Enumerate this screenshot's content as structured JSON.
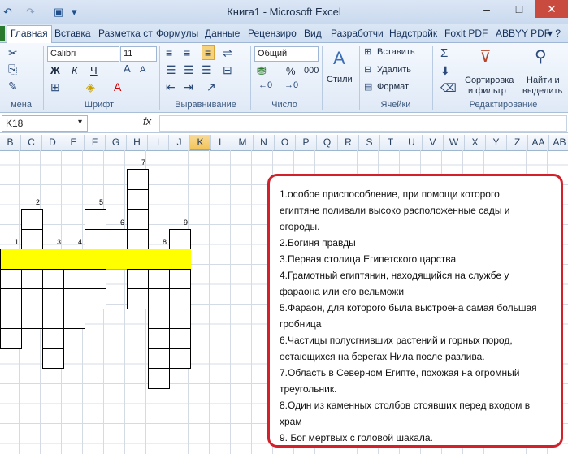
{
  "window": {
    "title": "Книга1 - Microsoft Excel"
  },
  "tabs": [
    "Главная",
    "Вставка",
    "Разметка ст",
    "Формулы",
    "Данные",
    "Рецензиро",
    "Вид",
    "Разработчи",
    "Надстройк",
    "Foxit PDF",
    "ABBYY PDF"
  ],
  "active_tab": "Главная",
  "ribbon": {
    "font_name": "Calibri",
    "font_size": "11",
    "number_format": "Общий",
    "bold": "Ж",
    "italic": "К",
    "underline": "Ч",
    "percent": "%",
    "thousands": "000",
    "styles": "Стили",
    "insert": "Вставить",
    "delete": "Удалить",
    "format": "Формат",
    "sort_filter_1": "Сортировка",
    "sort_filter_2": "и фильтр",
    "find_select_1": "Найти и",
    "find_select_2": "выделить",
    "groups": {
      "clipboard": "мена",
      "font": "Шрифт",
      "alignment": "Выравнивание",
      "number": "Число",
      "cells": "Ячейки",
      "editing": "Редактирование"
    }
  },
  "formula_bar": {
    "name_box": "K18",
    "fx": "fx",
    "content": ""
  },
  "columns": [
    "B",
    "C",
    "D",
    "E",
    "F",
    "G",
    "H",
    "I",
    "J",
    "K",
    "L",
    "M",
    "N",
    "O",
    "P",
    "Q",
    "R",
    "S",
    "T",
    "U",
    "V",
    "W",
    "X",
    "Y",
    "Z",
    "AA",
    "AB"
  ],
  "selected_column": "K",
  "crossword": {
    "numbers": [
      "1",
      "2",
      "3",
      "4",
      "5",
      "6",
      "7",
      "8",
      "9"
    ]
  },
  "clues": [
    "1.особое приспособление, при помощи которого",
    "египтяне поливали высоко расположенные сады и",
    "огороды.",
    "2.Богиня правды",
    "3.Первая столица Египетского царства",
    "4.Грамотный египтянин, находящийся на службе у",
    "фараона или его вельможи",
    "5.Фараон, для которого была выстроена самая большая",
    "гробница",
    "6.Частицы полусгнивших растений и горных пород,",
    "остающихся на берегах Нила после разлива.",
    "7.Область в Северном Египте, похожая на огромный",
    "треугольник.",
    "8.Один из каменных столбов стоявших перед входом в",
    "храм",
    "9. Бог мертвых с головой шакала."
  ],
  "colors": {
    "highlight_row": "#ffff00",
    "clue_border": "#d3202a",
    "selected_header": "#f3c55a"
  }
}
